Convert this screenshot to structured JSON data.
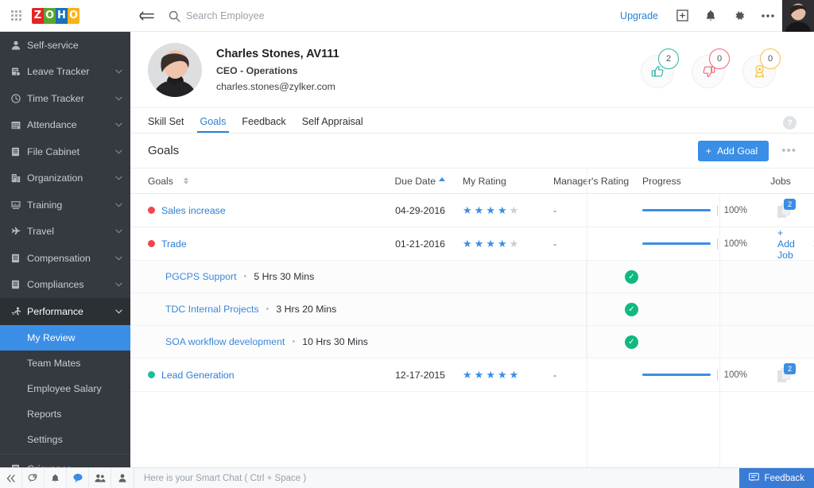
{
  "topbar": {
    "grid_icon": "apps-grid-icon",
    "logo": [
      "Z",
      "O",
      "H",
      "O"
    ],
    "collapse_icon": "collapse-sidebar-icon",
    "search_icon": "search-icon",
    "search_placeholder": "Search Employee",
    "search_value": "",
    "upgrade_label": "Upgrade",
    "add_icon": "plus-square-icon",
    "bell_icon": "bell-icon",
    "gear_icon": "gear-icon",
    "more_icon": "ellipsis-icon",
    "avatar": "user-avatar"
  },
  "sidebar": {
    "items": [
      {
        "label": "Self-service",
        "icon": "person-icon",
        "chevron": false
      },
      {
        "label": "Leave Tracker",
        "icon": "calendar-check-icon",
        "chevron": true
      },
      {
        "label": "Time Tracker",
        "icon": "clock-icon",
        "chevron": true
      },
      {
        "label": "Attendance",
        "icon": "calendar-icon",
        "chevron": true
      },
      {
        "label": "File Cabinet",
        "icon": "document-icon",
        "chevron": true
      },
      {
        "label": "Organization",
        "icon": "building-icon",
        "chevron": true
      },
      {
        "label": "Training",
        "icon": "training-icon",
        "chevron": true
      },
      {
        "label": "Travel",
        "icon": "plane-icon",
        "chevron": true
      },
      {
        "label": "Compensation",
        "icon": "document-icon",
        "chevron": true
      },
      {
        "label": "Compliances",
        "icon": "document-icon",
        "chevron": true
      }
    ],
    "performance": {
      "label": "Performance",
      "icon": "performance-icon",
      "chevron": true,
      "expanded": true
    },
    "performance_children": [
      {
        "label": "My Review",
        "active": true
      },
      {
        "label": "Team Mates",
        "active": false
      },
      {
        "label": "Employee Salary",
        "active": false
      },
      {
        "label": "Reports",
        "active": false
      },
      {
        "label": "Settings",
        "active": false
      }
    ],
    "after": [
      {
        "label": "Grievance",
        "icon": "document-icon",
        "chevron": true
      }
    ]
  },
  "profile": {
    "name": "Charles Stones, AV111",
    "role": "CEO - Operations",
    "email": "charles.stones@zylker.com",
    "badges": [
      {
        "name": "thumbs-up-badge",
        "count": "2",
        "color": "#2bb5a0",
        "icon": "thumbs-up-icon"
      },
      {
        "name": "thumbs-down-badge",
        "count": "0",
        "color": "#f2646f",
        "icon": "thumbs-down-icon"
      },
      {
        "name": "award-badge",
        "count": "0",
        "color": "#f5c242",
        "icon": "award-ribbon-icon"
      }
    ]
  },
  "tabs": [
    {
      "label": "Skill Set",
      "active": false
    },
    {
      "label": "Goals",
      "active": true
    },
    {
      "label": "Feedback",
      "active": false
    },
    {
      "label": "Self Appraisal",
      "active": false
    }
  ],
  "help_icon_label": "?",
  "goals_section": {
    "title": "Goals",
    "add_goal_label": "Add Goal",
    "add_goal_plus": "+",
    "more_label": "•••"
  },
  "table": {
    "columns": [
      "Goals",
      "Due Date",
      "My Rating",
      "Manager's Rating",
      "Progress",
      "Jobs"
    ],
    "rows": [
      {
        "type": "goal",
        "status_color": "#f4454f",
        "name": "Sales increase",
        "due_date": "04-29-2016",
        "my_rating": 4,
        "rating_max": 5,
        "managers_rating": "-",
        "progress_pct": "100%",
        "progress_value": 100,
        "jobs_count": "2",
        "has_add_job": false,
        "add_job_label": "",
        "close_label": ""
      },
      {
        "type": "goal",
        "status_color": "#f4454f",
        "name": "Trade",
        "due_date": "01-21-2016",
        "my_rating": 4,
        "rating_max": 5,
        "managers_rating": "-",
        "progress_pct": "100%",
        "progress_value": 100,
        "jobs_count": "",
        "has_add_job": true,
        "add_job_label": "+ Add Job",
        "close_label": "✕"
      },
      {
        "type": "job",
        "name": "PGCPS Support",
        "separator": "•",
        "hours": "5 Hrs 30 Mins",
        "status_icon": "check-circle-icon"
      },
      {
        "type": "job",
        "name": "TDC Internal Projects",
        "separator": "•",
        "hours": "3 Hrs 20 Mins",
        "status_icon": "check-circle-icon"
      },
      {
        "type": "job",
        "name": "SOA workflow development",
        "separator": "•",
        "hours": "10 Hrs 30 Mins",
        "status_icon": "check-circle-icon"
      },
      {
        "type": "goal",
        "status_color": "#13c296",
        "name": "Lead Generation",
        "due_date": "12-17-2015",
        "my_rating": 5,
        "rating_max": 5,
        "managers_rating": "-",
        "progress_pct": "100%",
        "progress_value": 100,
        "jobs_count": "2",
        "has_add_job": false,
        "add_job_label": "",
        "close_label": ""
      }
    ]
  },
  "bottombar": {
    "icons": [
      {
        "name": "collapse-chat-icon",
        "glyph": "«"
      },
      {
        "name": "chat-bubble-icon",
        "glyph": "◔"
      },
      {
        "name": "bell-icon",
        "glyph": "♣"
      },
      {
        "name": "smart-chat-icon",
        "glyph": "◉"
      },
      {
        "name": "contacts-icon",
        "glyph": "👥"
      },
      {
        "name": "person-icon",
        "glyph": "👤"
      }
    ],
    "chat_placeholder": "Here is your Smart Chat ( Ctrl + Space )",
    "feedback_label": "Feedback",
    "feedback_icon": "feedback-icon"
  },
  "colors": {
    "accent": "#3a8ee6",
    "link": "#2a7fd4",
    "sidebar_bg": "#343a40",
    "sidebar_active": "#3a8ee6",
    "status_red": "#f4454f",
    "status_green": "#13c296",
    "check_green": "#10b981",
    "danger": "#e8646b"
  }
}
